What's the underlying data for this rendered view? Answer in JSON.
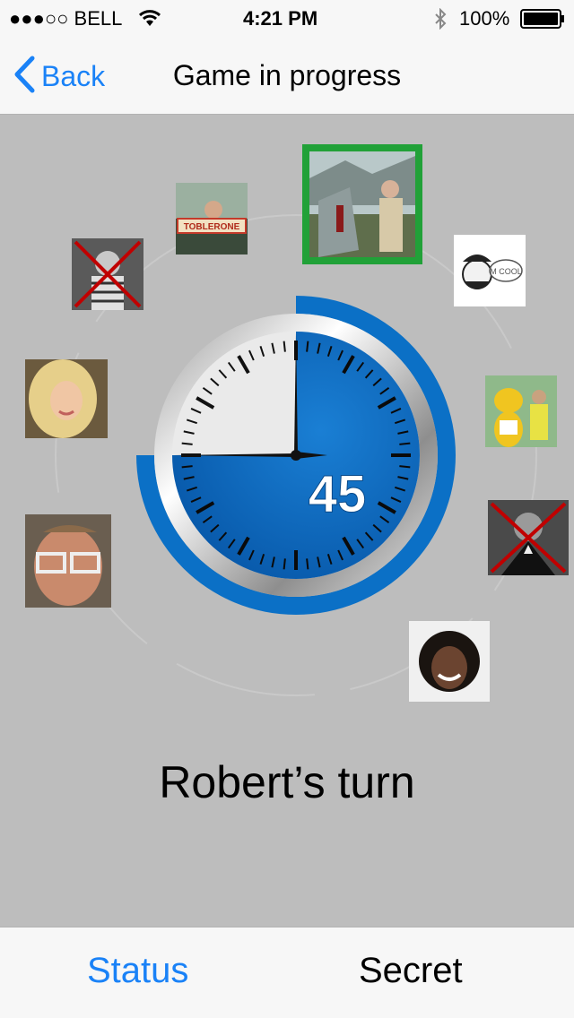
{
  "status_bar": {
    "carrier": "●●●○○ BELL",
    "time": "4:21 PM",
    "battery": "100%",
    "icons": [
      "wifi-icon",
      "bluetooth-icon",
      "battery-icon"
    ]
  },
  "nav": {
    "back_label": "Back",
    "title": "Game in progress"
  },
  "game": {
    "timer_value": "45",
    "timer_remaining_fraction": 0.75,
    "turn_text": "Robert’s turn",
    "players": [
      {
        "id": "player-active",
        "active": true,
        "eliminated": false
      },
      {
        "id": "player-cool",
        "active": false,
        "eliminated": false
      },
      {
        "id": "player-mascot",
        "active": false,
        "eliminated": false
      },
      {
        "id": "player-tuxedo",
        "active": false,
        "eliminated": true
      },
      {
        "id": "player-smiling-woman",
        "active": false,
        "eliminated": false
      },
      {
        "id": "player-glasses-man",
        "active": false,
        "eliminated": false
      },
      {
        "id": "player-blonde",
        "active": false,
        "eliminated": false
      },
      {
        "id": "player-bw-man",
        "active": false,
        "eliminated": true
      },
      {
        "id": "player-toblerone",
        "active": false,
        "eliminated": false
      }
    ]
  },
  "tabs": {
    "status_label": "Status",
    "secret_label": "Secret"
  },
  "colors": {
    "ios_blue": "#1a82f7",
    "timer_blue": "#0a62b3",
    "active_border": "#21a138",
    "eliminated_x": "#c00000",
    "background": "#bdbdbd"
  }
}
